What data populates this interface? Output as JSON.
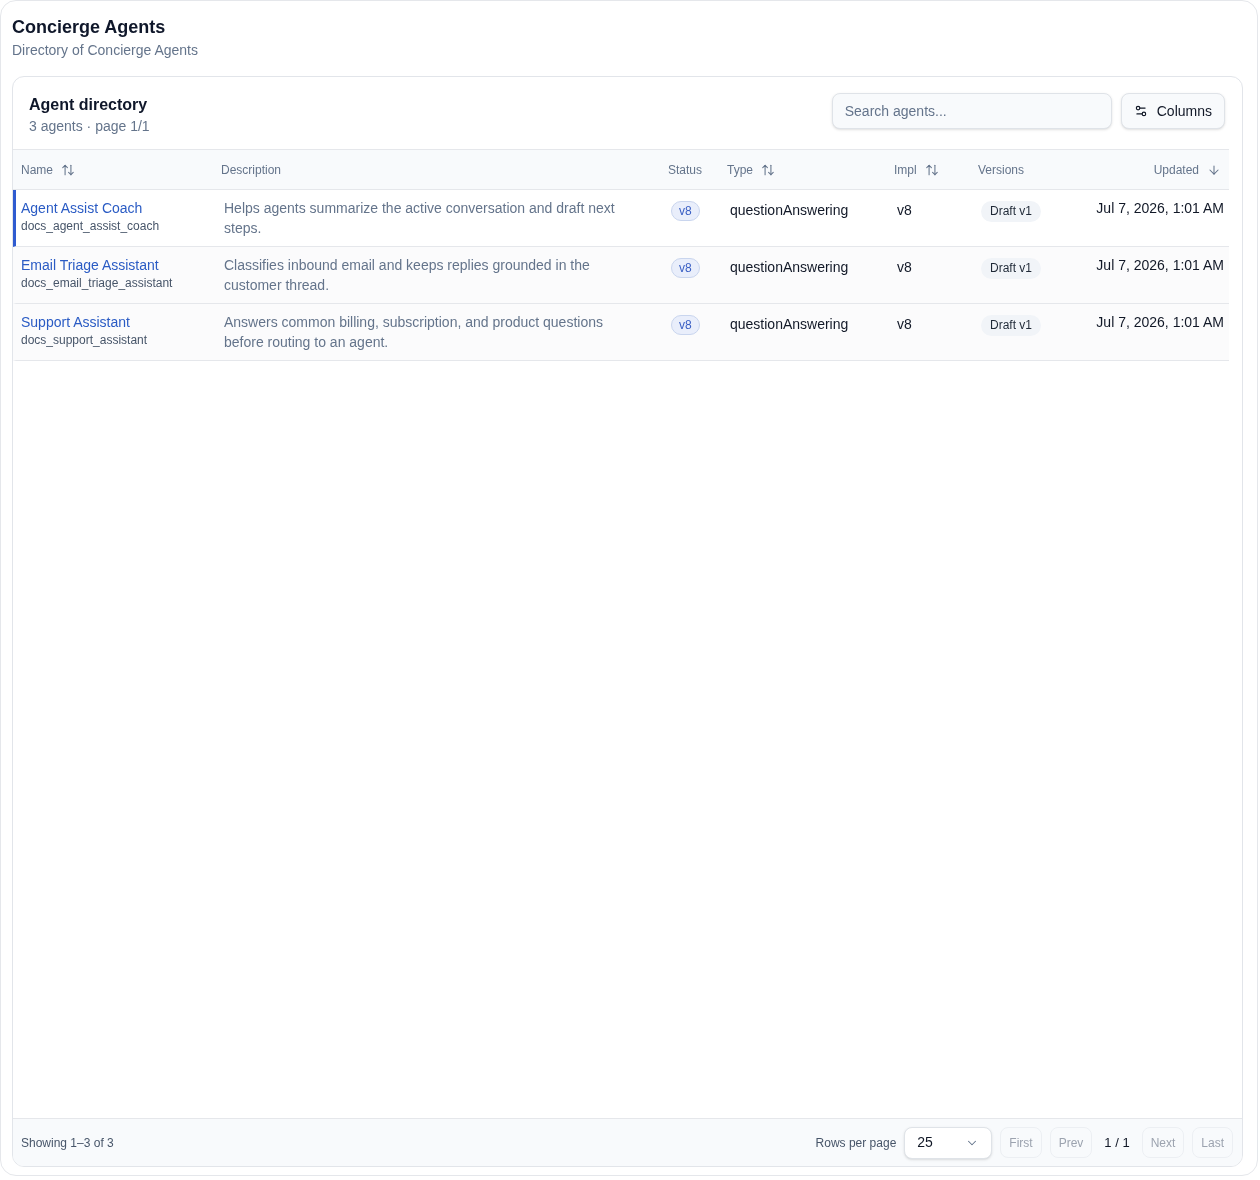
{
  "page": {
    "title": "Concierge Agents",
    "subtitle": "Directory of Concierge Agents"
  },
  "card": {
    "title": "Agent directory",
    "summary": "3 agents · page 1/1",
    "search": {
      "placeholder": "Search agents..."
    },
    "columns_button": "Columns"
  },
  "table": {
    "columns": [
      {
        "label": "Name",
        "kind": "sortable"
      },
      {
        "label": "Description",
        "kind": "plain"
      },
      {
        "label": "Status",
        "kind": "plain"
      },
      {
        "label": "Type",
        "kind": "sortable"
      },
      {
        "label": "Impl",
        "kind": "sortable"
      },
      {
        "label": "Versions",
        "kind": "plain"
      },
      {
        "label": "Updated",
        "kind": "sorted"
      }
    ],
    "rows": [
      {
        "name": "Agent Assist Coach",
        "id": "docs_agent_assist_coach",
        "description": "Helps agents summarize the active conversation and draft next steps.",
        "status": "v8",
        "type": "questionAnswering",
        "impl": "v8",
        "versions": "Draft v1",
        "updated": "Jul 7, 2026, 1:01 AM",
        "selected": true
      },
      {
        "name": "Email Triage Assistant",
        "id": "docs_email_triage_assistant",
        "description": "Classifies inbound email and keeps replies grounded in the customer thread.",
        "status": "v8",
        "type": "questionAnswering",
        "impl": "v8",
        "versions": "Draft v1",
        "updated": "Jul 7, 2026, 1:01 AM",
        "selected": false
      },
      {
        "name": "Support Assistant",
        "id": "docs_support_assistant",
        "description": "Answers common billing, subscription, and product questions before routing to an agent.",
        "status": "v8",
        "type": "questionAnswering",
        "impl": "v8",
        "versions": "Draft v1",
        "updated": "Jul 7, 2026, 1:01 AM",
        "selected": false
      }
    ]
  },
  "footer": {
    "showing": "Showing 1–3 of 3",
    "rows_per_page_label": "Rows per page",
    "rows_per_page": "25",
    "pagination": [
      {
        "kind": "button",
        "label": "First",
        "disabled": true
      },
      {
        "kind": "button",
        "label": "Prev",
        "disabled": true
      },
      {
        "kind": "indicator",
        "label": "1 / 1"
      },
      {
        "kind": "button",
        "label": "Next",
        "disabled": true
      },
      {
        "kind": "button",
        "label": "Last",
        "disabled": true
      }
    ]
  }
}
